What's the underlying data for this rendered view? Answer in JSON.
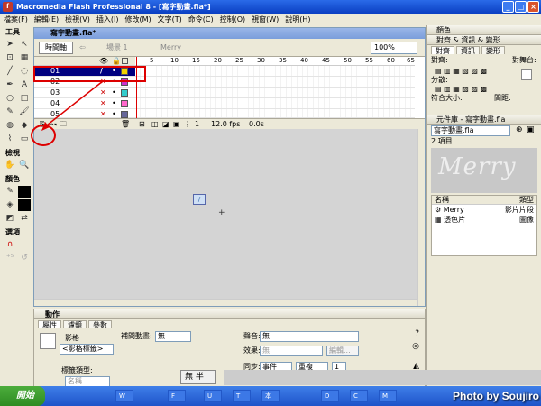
{
  "window": {
    "title": "Macromedia Flash Professional 8 - [寫字動畫.fla*]"
  },
  "menu": [
    "檔案(F)",
    "編輯(E)",
    "檢視(V)",
    "插入(I)",
    "修改(M)",
    "文字(T)",
    "命令(C)",
    "控制(O)",
    "視窗(W)",
    "說明(H)"
  ],
  "tools": {
    "title": "工具",
    "view_label": "檢視",
    "colors_label": "顏色",
    "options_label": "選項"
  },
  "document": {
    "tab_title": "寫字動畫.fla*",
    "timeline_button": "時間軸",
    "scene": "場景 1",
    "symbol": "Merry",
    "zoom": "100%"
  },
  "timeline": {
    "frame_numbers": [
      "5",
      "10",
      "15",
      "20",
      "25",
      "30",
      "35",
      "40",
      "45",
      "50",
      "55",
      "60",
      "65"
    ],
    "layers": [
      {
        "name": "01",
        "color": "#f2d200"
      },
      {
        "name": "02",
        "color": "#cc33cc"
      },
      {
        "name": "03",
        "color": "#33cccc"
      },
      {
        "name": "04",
        "color": "#ff66cc"
      },
      {
        "name": "05",
        "color": "#666699"
      }
    ],
    "current_frame": "1",
    "fps": "12.0 fps",
    "time": "0.0s"
  },
  "properties": {
    "panel_title": "動作",
    "tabs": [
      "屬性",
      "濾鏡",
      "參數"
    ],
    "type_label": "影格",
    "frame_label_placeholder": "<影格標籤>",
    "tween_label": "補間動畫:",
    "tween_value": "無",
    "sound_label": "聲音:",
    "sound_value": "無",
    "effect_label": "效果:",
    "effect_value": "無",
    "edit_button": "編輯...",
    "sync_label": "同步:",
    "sync_value": "事件",
    "repeat_value": "重複",
    "repeat_count": "1",
    "label_type_label": "標籤類型:",
    "label_type_value": "名稱"
  },
  "right_panel": {
    "color_title": "顏色",
    "align_title": "對齊 & 資訊 & 變形",
    "align_tabs": [
      "對齊",
      "資訊",
      "變形"
    ],
    "align_label": "對齊:",
    "distribute_label": "分散:",
    "match_size_label": "符合大小:",
    "space_label": "間距:",
    "to_stage_label": "對舞台:",
    "library_title": "元件庫 - 寫字動畫.fla",
    "library_file": "寫字動畫.fla",
    "item_count": "2 項目",
    "preview_text": "Merry",
    "col_name": "名稱",
    "col_type": "類型",
    "items": [
      {
        "name": "Merry",
        "type": "影片片段"
      },
      {
        "name": "透色片",
        "type": "圖像"
      }
    ]
  },
  "ime": "無 半",
  "taskbar": {
    "start": "開始",
    "tasks": [
      "W",
      "F",
      "U",
      "T",
      "本",
      "D",
      "C",
      "M"
    ]
  },
  "credit": "Photo by Soujiro"
}
